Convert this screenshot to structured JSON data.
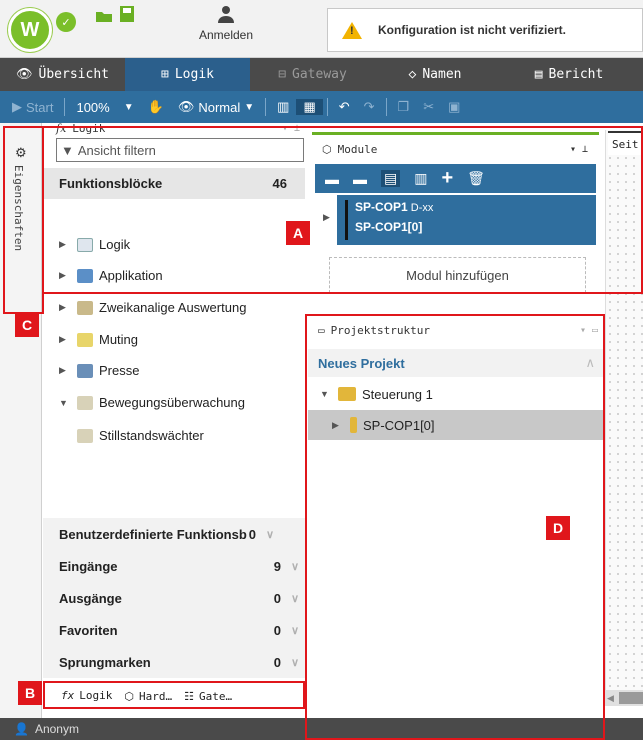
{
  "topbar": {
    "login_label": "Anmelden",
    "warning_text": "Konfiguration ist nicht verifiziert."
  },
  "nav": [
    {
      "label": "Übersicht",
      "icon": "eye-icon"
    },
    {
      "label": "Logik",
      "icon": "logic-icon"
    },
    {
      "label": "Gateway",
      "icon": "gateway-icon"
    },
    {
      "label": "Namen",
      "icon": "tag-icon"
    },
    {
      "label": "Bericht",
      "icon": "report-icon"
    }
  ],
  "toolbar": {
    "start_label": "Start",
    "zoom": "100%",
    "view_mode": "Normal"
  },
  "sidebar": {
    "label": "Eigenschaften"
  },
  "logik_panel": {
    "title": "Logik",
    "filter_placeholder": "Ansicht filtern",
    "funktionsbloecke": {
      "label": "Funktionsblöcke",
      "count": "46"
    },
    "groups": [
      "Logik",
      "Applikation",
      "Zweikanalige Auswertung",
      "Muting",
      "Presse",
      "Bewegungsüberwachung"
    ],
    "leaf": "Stillstandswächter",
    "summary": [
      {
        "label": "Benutzerdefinierte Funktionsb",
        "count": "0"
      },
      {
        "label": "Eingänge",
        "count": "9"
      },
      {
        "label": "Ausgänge",
        "count": "0"
      },
      {
        "label": "Favoriten",
        "count": "0"
      },
      {
        "label": "Sprungmarken",
        "count": "0"
      }
    ],
    "bottom_tabs": [
      "Logik",
      "Hard…",
      "Gate…"
    ]
  },
  "module_panel": {
    "title": "Module",
    "card_line1_bold": "SP-COP1",
    "card_line1_rest": " D-xx",
    "card_line2": "SP-COP1[0]",
    "add_label": "Modul hinzufügen"
  },
  "project_panel": {
    "title": "Projektstruktur",
    "project_name": "Neues Projekt",
    "controller": "Steuerung 1",
    "module": "SP-COP1[0]"
  },
  "canvas": {
    "tab_label": "Seit"
  },
  "status": {
    "user": "Anonym"
  },
  "callouts": [
    "A",
    "B",
    "C",
    "D"
  ],
  "colors": {
    "accent": "#2f6e9e",
    "green": "#6ab023",
    "callout_red": "#e0161b",
    "nav_dark": "#4a4a4a"
  }
}
